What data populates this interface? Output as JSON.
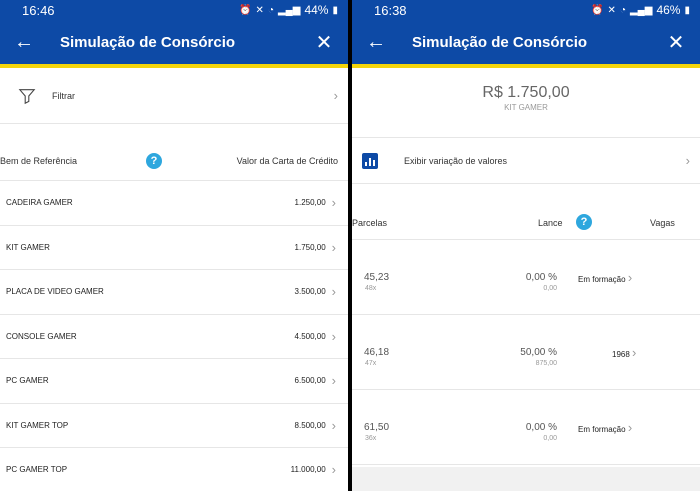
{
  "left": {
    "status": {
      "time": "16:46",
      "battery": "44%"
    },
    "appbar": {
      "title": "Simulação de Consórcio"
    },
    "filter": {
      "label": "Filtrar"
    },
    "table_header": {
      "col1": "Bem de Referência",
      "col2": "Valor da Carta de Crédito",
      "help": "?"
    },
    "rows": [
      {
        "name": "CADEIRA GAMER",
        "value": "1.250,00"
      },
      {
        "name": "KIT GAMER",
        "value": "1.750,00"
      },
      {
        "name": "PLACA DE VIDEO GAMER",
        "value": "3.500,00"
      },
      {
        "name": "CONSOLE GAMER",
        "value": "4.500,00"
      },
      {
        "name": "PC GAMER",
        "value": "6.500,00"
      },
      {
        "name": "KIT GAMER TOP",
        "value": "8.500,00"
      },
      {
        "name": "PC GAMER TOP",
        "value": "11.000,00"
      }
    ]
  },
  "right": {
    "status": {
      "time": "16:38",
      "battery": "46%"
    },
    "appbar": {
      "title": "Simulação de Consórcio"
    },
    "price": {
      "value": "R$ 1.750,00",
      "product": "KIT GAMER"
    },
    "variation": {
      "label": "Exibir variação de valores"
    },
    "header": {
      "parcelas": "Parcelas",
      "lance": "Lance",
      "vagas": "Vagas",
      "help": "?"
    },
    "rows": [
      {
        "amount": "45,23",
        "times": "48x",
        "pct": "0,00 %",
        "lance_val": "0,00",
        "vagas": "Em formação"
      },
      {
        "amount": "46,18",
        "times": "47x",
        "pct": "50,00 %",
        "lance_val": "875,00",
        "vagas": "1968"
      },
      {
        "amount": "61,50",
        "times": "36x",
        "pct": "0,00 %",
        "lance_val": "0,00",
        "vagas": "Em formação"
      }
    ]
  },
  "colors": {
    "primary": "#0d4aa6",
    "accent": "#f4d50b",
    "help": "#2ea7de"
  },
  "icons": {
    "back": "arrow-left-icon",
    "close": "close-icon",
    "filter": "funnel-icon",
    "chart": "bar-chart-icon",
    "chevron": "chevron-right-icon",
    "help": "question-circle-icon"
  }
}
